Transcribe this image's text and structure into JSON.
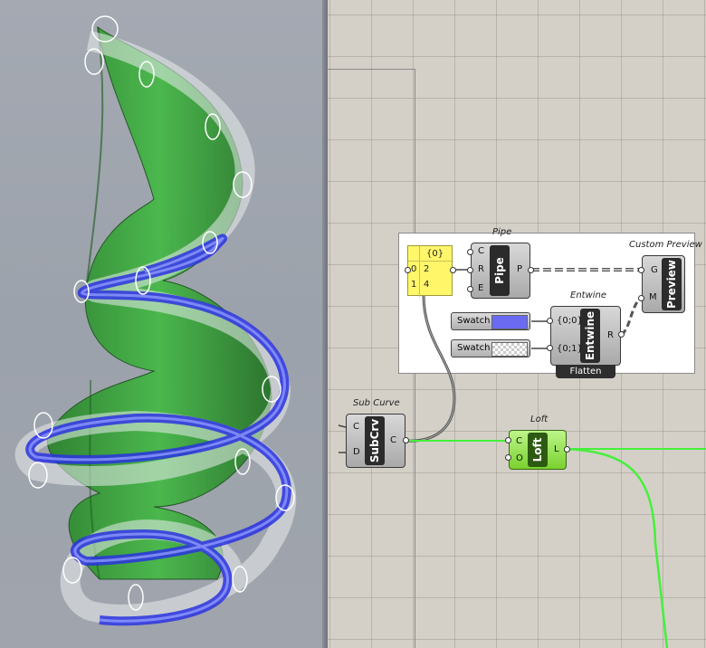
{
  "viewport": {
    "name": "Rhino perspective viewport",
    "colors": {
      "background": "#a0a5ad",
      "surface": "#2e9e2e",
      "pipe": "#2a32e0"
    }
  },
  "canvas": {
    "colors": {
      "background": "#d4d0c8",
      "wire_green": "#45f03a",
      "component": "#b8b8b8",
      "panel": "#fff669"
    },
    "titles": {
      "pipe": "Pipe",
      "custom_preview": "Custom Preview",
      "entwine": "Entwine",
      "sub_curve": "Sub Curve",
      "loft": "Loft"
    },
    "panel": {
      "header": "{0}",
      "rows": [
        {
          "index": "0",
          "value": "2"
        },
        {
          "index": "1",
          "value": "4"
        }
      ]
    },
    "pipe": {
      "label": "Pipe",
      "inputs": [
        "C",
        "R",
        "E"
      ],
      "outputs": [
        "P"
      ]
    },
    "custom_preview": {
      "label": "Preview",
      "inputs": [
        "G",
        "M"
      ]
    },
    "swatches": [
      {
        "label": "Swatch",
        "color": "#6b6bf2"
      },
      {
        "label": "Swatch",
        "color": "checker"
      }
    ],
    "entwine": {
      "label": "Entwine",
      "inputs": [
        "{0;0}",
        "{0;1}"
      ],
      "outputs": [
        "R"
      ],
      "flag": "Flatten"
    },
    "subcrv": {
      "label": "SubCrv",
      "inputs": [
        "C",
        "D"
      ],
      "outputs": [
        "C"
      ]
    },
    "loft": {
      "label": "Loft",
      "inputs": [
        "C",
        "O"
      ],
      "outputs": [
        "L"
      ]
    }
  }
}
